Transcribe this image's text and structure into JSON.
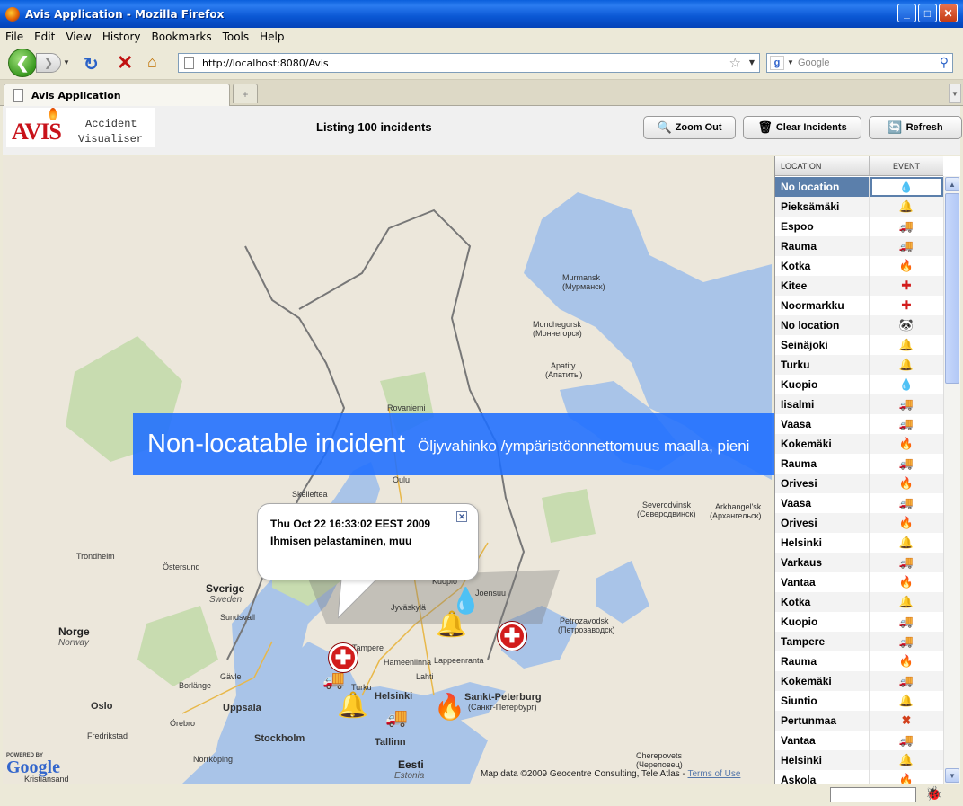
{
  "window": {
    "title": "Avis Application - Mozilla Firefox"
  },
  "menu": [
    "File",
    "Edit",
    "View",
    "History",
    "Bookmarks",
    "Tools",
    "Help"
  ],
  "nav": {
    "url": "http://localhost:8080/Avis",
    "search_placeholder": "Google"
  },
  "tabs": [
    {
      "label": "Avis Application"
    }
  ],
  "app": {
    "logo_text": "AVIS",
    "logo_sub1": "Accident",
    "logo_sub2": "Visualiser",
    "listing": "Listing 100 incidents",
    "buttons": {
      "zoom_out": "Zoom Out",
      "clear": "Clear Incidents",
      "refresh": "Refresh"
    }
  },
  "map": {
    "attribution": "Map data ©2009 Geocentre Consulting, Tele Atlas -",
    "terms": "Terms of Use",
    "google_powered": "POWERED BY",
    "google": "Google",
    "labels": {
      "murmansk": "Murmansk",
      "murmansk_ru": "(Мурманск)",
      "monchegorsk": "Monchegorsk",
      "monchegorsk_ru": "(Мончегорск)",
      "apatity": "Apatity",
      "apatity_ru": "(Апатиты)",
      "rovaniemi": "Rovaniemi",
      "oulu": "Oulu",
      "skelleftea": "Skelleftea",
      "severodvinsk": "Severodvinsk",
      "severodvinsk_ru": "(Северодвинск)",
      "arkhangelsk": "Arkhangel'sk",
      "arkhangelsk_ru": "(Архангельск)",
      "trondheim": "Trondheim",
      "ostersund": "Östersund",
      "sverige": "Sverige",
      "sweden": "Sweden",
      "sundsvall": "Sundsvall",
      "norge": "Norge",
      "norway": "Norway",
      "jyvaskyla": "Jyväskylä",
      "joensuu": "Joensuu",
      "kuopio": "Kuopio",
      "tampere": "Tampere",
      "hameenlinna": "Hameenlinna",
      "lappeenranta": "Lappeenranta",
      "turku": "Turku",
      "helsinki": "Helsinki",
      "petrozavodsk": "Petrozavodsk",
      "petrozavodsk_ru": "(Петрозаводск)",
      "spb": "Sankt-Peterburg",
      "spb_ru": "(Санкт-Петербург)",
      "gavle": "Gävle",
      "uppsala": "Uppsala",
      "stockholm": "Stockholm",
      "tallinn": "Tallinn",
      "eesti": "Eesti",
      "estonia": "Estonia",
      "oslo": "Oslo",
      "borlange": "Borlänge",
      "orebro": "Örebro",
      "norrkoping": "Norrköping",
      "cherepovets": "Cherepovets",
      "cherepovets_ru": "(Череповец)",
      "kristiansand": "Kristiansand",
      "fredrikstad": "Fredrikstad",
      "lahti": "Lahti"
    }
  },
  "infowindow": {
    "line1": "Thu Oct 22 16:33:02 EEST 2009",
    "line2": "Ihmisen pelastaminen, muu"
  },
  "banner": {
    "title": "Non-locatable incident",
    "detail": "Öljyvahinko /ympäristöonnettomuus maalla, pieni"
  },
  "grid": {
    "headers": {
      "location": "LOCATION",
      "event": "EVENT"
    },
    "rows": [
      {
        "loc": "No location",
        "ev": "drop-icon"
      },
      {
        "loc": "Pieksämäki",
        "ev": "bell-icon"
      },
      {
        "loc": "Espoo",
        "ev": "truck-icon"
      },
      {
        "loc": "Rauma",
        "ev": "truck-icon"
      },
      {
        "loc": "Kotka",
        "ev": "fire-icon"
      },
      {
        "loc": "Kitee",
        "ev": "rescue-icon"
      },
      {
        "loc": "Noormarkku",
        "ev": "rescue-icon"
      },
      {
        "loc": "No location",
        "ev": "animal-icon"
      },
      {
        "loc": "Seinäjoki",
        "ev": "bell-icon"
      },
      {
        "loc": "Turku",
        "ev": "bell-icon"
      },
      {
        "loc": "Kuopio",
        "ev": "drop-icon"
      },
      {
        "loc": "Iisalmi",
        "ev": "truck-icon"
      },
      {
        "loc": "Vaasa",
        "ev": "truck-icon"
      },
      {
        "loc": "Kokemäki",
        "ev": "fire-icon"
      },
      {
        "loc": "Rauma",
        "ev": "truck-icon"
      },
      {
        "loc": "Orivesi",
        "ev": "fire-icon"
      },
      {
        "loc": "Vaasa",
        "ev": "truck-icon"
      },
      {
        "loc": "Orivesi",
        "ev": "fire-icon"
      },
      {
        "loc": "Helsinki",
        "ev": "bell-icon"
      },
      {
        "loc": "Varkaus",
        "ev": "truck-icon"
      },
      {
        "loc": "Vantaa",
        "ev": "fire-icon"
      },
      {
        "loc": "Kotka",
        "ev": "bell-icon"
      },
      {
        "loc": "Kuopio",
        "ev": "truck-icon"
      },
      {
        "loc": "Tampere",
        "ev": "truck-icon"
      },
      {
        "loc": "Rauma",
        "ev": "fire-icon"
      },
      {
        "loc": "Kokemäki",
        "ev": "truck-icon"
      },
      {
        "loc": "Siuntio",
        "ev": "bell-icon"
      },
      {
        "loc": "Pertunmaa",
        "ev": "cancel-icon"
      },
      {
        "loc": "Vantaa",
        "ev": "truck-icon"
      },
      {
        "loc": "Helsinki",
        "ev": "bell-icon"
      },
      {
        "loc": "Askola",
        "ev": "fire-icon"
      }
    ]
  },
  "icons": {
    "drop-icon": "💧",
    "bell-icon": "🔔",
    "truck-icon": "🚚",
    "fire-icon": "🔥",
    "rescue-icon": "✚",
    "animal-icon": "🐼",
    "cancel-icon": "✖"
  },
  "colors": {
    "selected_row": "#5b7fab",
    "banner": "#1e6eff",
    "rescue": "#d21c1c"
  }
}
